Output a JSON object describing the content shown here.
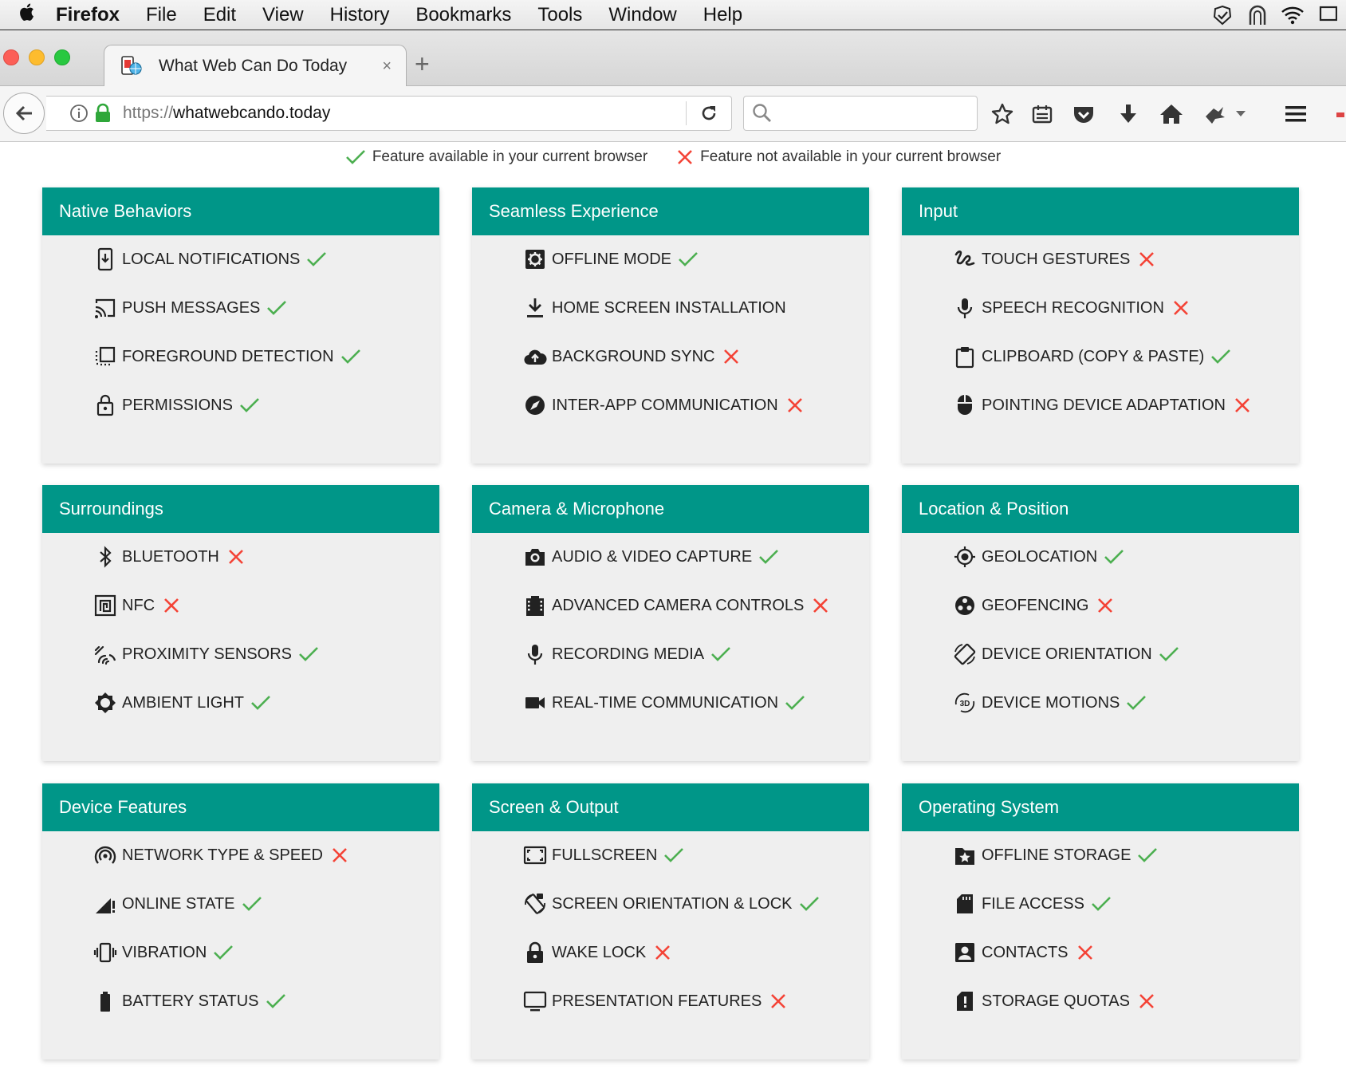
{
  "menubar": {
    "app": "Firefox",
    "items": [
      "File",
      "Edit",
      "View",
      "History",
      "Bookmarks",
      "Tools",
      "Window",
      "Help"
    ]
  },
  "tab": {
    "title": "What Web Can Do Today",
    "close": "×",
    "new_tab": "+"
  },
  "url": {
    "scheme": "https://",
    "host": "whatwebcando.today"
  },
  "legend": {
    "available": "Feature available in your current browser",
    "unavailable": "Feature not available in your current browser"
  },
  "colors": {
    "header": "#009688",
    "check": "#4caf50",
    "cross": "#f44336",
    "card_bg": "#efefef"
  },
  "cards": [
    {
      "title": "Native Behaviors",
      "features": [
        {
          "label": "LOCAL NOTIFICATIONS",
          "status": "available",
          "icon": "notification-icon"
        },
        {
          "label": "PUSH MESSAGES",
          "status": "available",
          "icon": "cast-icon"
        },
        {
          "label": "FOREGROUND DETECTION",
          "status": "available",
          "icon": "selection-icon"
        },
        {
          "label": "PERMISSIONS",
          "status": "available",
          "icon": "lock-open-icon"
        }
      ]
    },
    {
      "title": "Seamless Experience",
      "features": [
        {
          "label": "OFFLINE MODE",
          "status": "available",
          "icon": "settings-box-icon"
        },
        {
          "label": "HOME SCREEN INSTALLATION",
          "status": "none",
          "icon": "download-icon"
        },
        {
          "label": "BACKGROUND SYNC",
          "status": "unavailable",
          "icon": "cloud-upload-icon"
        },
        {
          "label": "INTER-APP COMMUNICATION",
          "status": "unavailable",
          "icon": "compass-icon"
        }
      ]
    },
    {
      "title": "Input",
      "features": [
        {
          "label": "TOUCH GESTURES",
          "status": "unavailable",
          "icon": "gesture-icon"
        },
        {
          "label": "SPEECH RECOGNITION",
          "status": "unavailable",
          "icon": "microphone-icon"
        },
        {
          "label": "CLIPBOARD (COPY & PASTE)",
          "status": "available",
          "icon": "clipboard-icon"
        },
        {
          "label": "POINTING DEVICE ADAPTATION",
          "status": "unavailable",
          "icon": "mouse-icon"
        }
      ]
    },
    {
      "title": "Surroundings",
      "features": [
        {
          "label": "BLUETOOTH",
          "status": "unavailable",
          "icon": "bluetooth-icon"
        },
        {
          "label": "NFC",
          "status": "unavailable",
          "icon": "nfc-icon"
        },
        {
          "label": "PROXIMITY SENSORS",
          "status": "available",
          "icon": "proximity-icon"
        },
        {
          "label": "AMBIENT LIGHT",
          "status": "available",
          "icon": "brightness-icon"
        }
      ]
    },
    {
      "title": "Camera & Microphone",
      "features": [
        {
          "label": "AUDIO & VIDEO CAPTURE",
          "status": "available",
          "icon": "camera-icon"
        },
        {
          "label": "ADVANCED CAMERA CONTROLS",
          "status": "unavailable",
          "icon": "film-icon"
        },
        {
          "label": "RECORDING MEDIA",
          "status": "available",
          "icon": "microphone-icon"
        },
        {
          "label": "REAL-TIME COMMUNICATION",
          "status": "available",
          "icon": "videocam-icon"
        }
      ]
    },
    {
      "title": "Location & Position",
      "features": [
        {
          "label": "GEOLOCATION",
          "status": "available",
          "icon": "gps-icon"
        },
        {
          "label": "GEOFENCING",
          "status": "unavailable",
          "icon": "geofence-icon"
        },
        {
          "label": "DEVICE ORIENTATION",
          "status": "available",
          "icon": "rotation-icon"
        },
        {
          "label": "DEVICE MOTIONS",
          "status": "available",
          "icon": "3d-rotation-icon"
        }
      ]
    },
    {
      "title": "Device Features",
      "features": [
        {
          "label": "NETWORK TYPE & SPEED",
          "status": "unavailable",
          "icon": "wifi-tethering-icon"
        },
        {
          "label": "ONLINE STATE",
          "status": "available",
          "icon": "signal-icon"
        },
        {
          "label": "VIBRATION",
          "status": "available",
          "icon": "vibration-icon"
        },
        {
          "label": "BATTERY STATUS",
          "status": "available",
          "icon": "battery-icon"
        }
      ]
    },
    {
      "title": "Screen & Output",
      "features": [
        {
          "label": "FULLSCREEN",
          "status": "available",
          "icon": "fullscreen-icon"
        },
        {
          "label": "SCREEN ORIENTATION & LOCK",
          "status": "available",
          "icon": "screen-rotation-icon"
        },
        {
          "label": "WAKE LOCK",
          "status": "unavailable",
          "icon": "lock-icon"
        },
        {
          "label": "PRESENTATION FEATURES",
          "status": "unavailable",
          "icon": "monitor-icon"
        }
      ]
    },
    {
      "title": "Operating System",
      "features": [
        {
          "label": "OFFLINE STORAGE",
          "status": "available",
          "icon": "folder-star-icon"
        },
        {
          "label": "FILE ACCESS",
          "status": "available",
          "icon": "sd-card-icon"
        },
        {
          "label": "CONTACTS",
          "status": "unavailable",
          "icon": "contact-icon"
        },
        {
          "label": "STORAGE QUOTAS",
          "status": "unavailable",
          "icon": "sd-alert-icon"
        }
      ]
    }
  ]
}
